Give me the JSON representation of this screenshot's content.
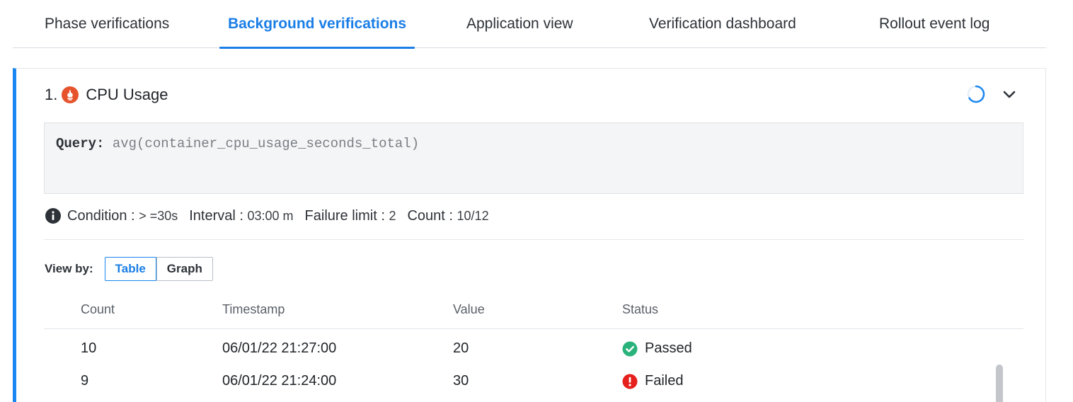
{
  "tabs": [
    {
      "label": "Phase verifications",
      "active": false
    },
    {
      "label": "Background verifications",
      "active": true
    },
    {
      "label": "Application view",
      "active": false
    },
    {
      "label": "Verification dashboard",
      "active": false
    },
    {
      "label": "Rollout event log",
      "active": false
    }
  ],
  "verification": {
    "number": "1.",
    "title": "CPU Usage",
    "icon": "prometheus-icon",
    "query_label": "Query:",
    "query": "avg(container_cpu_usage_seconds_total)",
    "conditions": [
      {
        "label": "Condition :",
        "value": "> =30s"
      },
      {
        "label": "Interval :",
        "value": "03:00 m"
      },
      {
        "label": "Failure limit :",
        "value": "2"
      },
      {
        "label": "Count :",
        "value": "10/12"
      }
    ],
    "view_by_label": "View by:",
    "view_options": [
      {
        "label": "Table",
        "active": true
      },
      {
        "label": "Graph",
        "active": false
      }
    ],
    "table": {
      "headers": [
        "Count",
        "Timestamp",
        "Value",
        "Status"
      ],
      "rows": [
        {
          "count": "10",
          "timestamp": "06/01/22 21:27:00",
          "value": "20",
          "status": "Passed",
          "status_color": "#2ab27b"
        },
        {
          "count": "9",
          "timestamp": "06/01/22 21:24:00",
          "value": "30",
          "status": "Failed",
          "status_color": "#e5201d"
        }
      ]
    }
  },
  "colors": {
    "accent": "#1a7ee6",
    "card_border": "#1a86f0",
    "prometheus": "#e6522c"
  }
}
